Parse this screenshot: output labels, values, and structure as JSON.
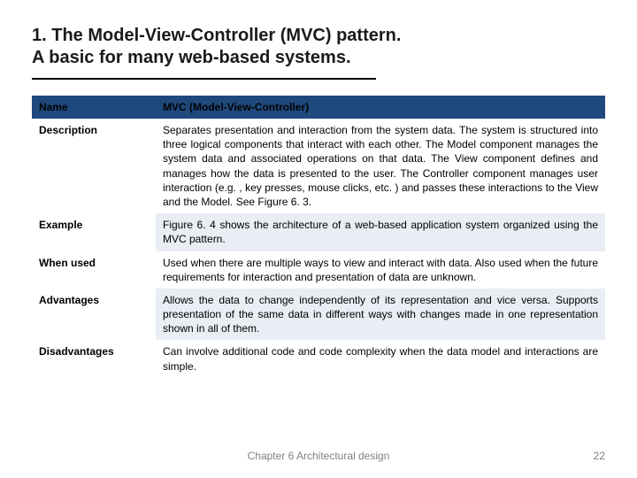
{
  "title_line1": "1. The Model-View-Controller (MVC) pattern.",
  "title_line2": "A basic for many web-based systems.",
  "table": {
    "header": {
      "left": "Name",
      "right": "MVC (Model-View-Controller)"
    },
    "rows": [
      {
        "label": "Description",
        "text": "Separates presentation and interaction from the system data. The system is structured into three logical components that interact with each other. The Model component manages the system data and associated operations on that data. The View component defines and manages how the data is presented to the user. The Controller component manages user interaction (e.g. , key presses, mouse clicks, etc. ) and passes these interactions to the View and the Model. See Figure 6. 3."
      },
      {
        "label": "Example",
        "text": "Figure 6. 4 shows the architecture of a web-based application system organized using the MVC pattern."
      },
      {
        "label": "When used",
        "text": "Used when there are multiple ways to view and interact with data. Also used when the future requirements for interaction and presentation of data are unknown."
      },
      {
        "label": "Advantages",
        "text": "Allows the data to change independently of its representation and vice versa. Supports presentation of the same data in different ways with changes made in one representation shown in all of them."
      },
      {
        "label": "Disadvantages",
        "text": "Can involve additional code and code complexity when the data model and interactions are simple."
      }
    ]
  },
  "footer": "Chapter 6 Architectural design",
  "page_number": "22"
}
